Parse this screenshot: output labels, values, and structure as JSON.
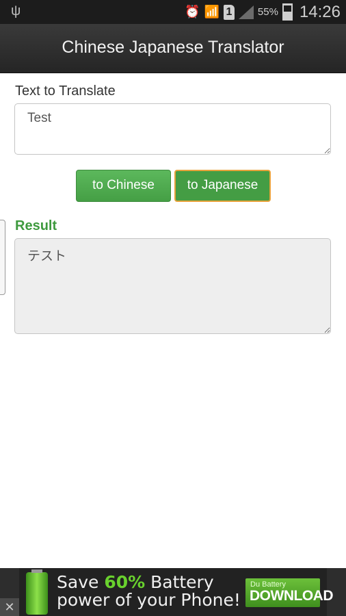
{
  "status_bar": {
    "usb_icon": "usb-icon",
    "alarm_icon": "alarm-clock-icon",
    "wifi_icon": "wifi-icon",
    "sim_slot": "1",
    "signal_icon": "cell-signal-icon",
    "battery_percent": "55%",
    "battery_icon": "battery-charging-icon",
    "time": "14:26"
  },
  "app_bar": {
    "title": "Chinese Japanese Translator"
  },
  "source": {
    "label": "Text to Translate",
    "value": "Test"
  },
  "buttons": {
    "to_chinese": "to Chinese",
    "to_japanese": "to Japanese"
  },
  "result": {
    "label": "Result",
    "value": "テスト"
  },
  "ad": {
    "line1_pre": "Save ",
    "line1_highlight": "60%",
    "line1_post": " Battery",
    "line2": "power of your Phone!",
    "brand": "Du Battery",
    "cta": "DOWNLOAD",
    "close": "✕"
  },
  "colors": {
    "accent_green": "#449d44",
    "result_label": "#3e9a3e",
    "focus_border": "#e8a33c"
  }
}
